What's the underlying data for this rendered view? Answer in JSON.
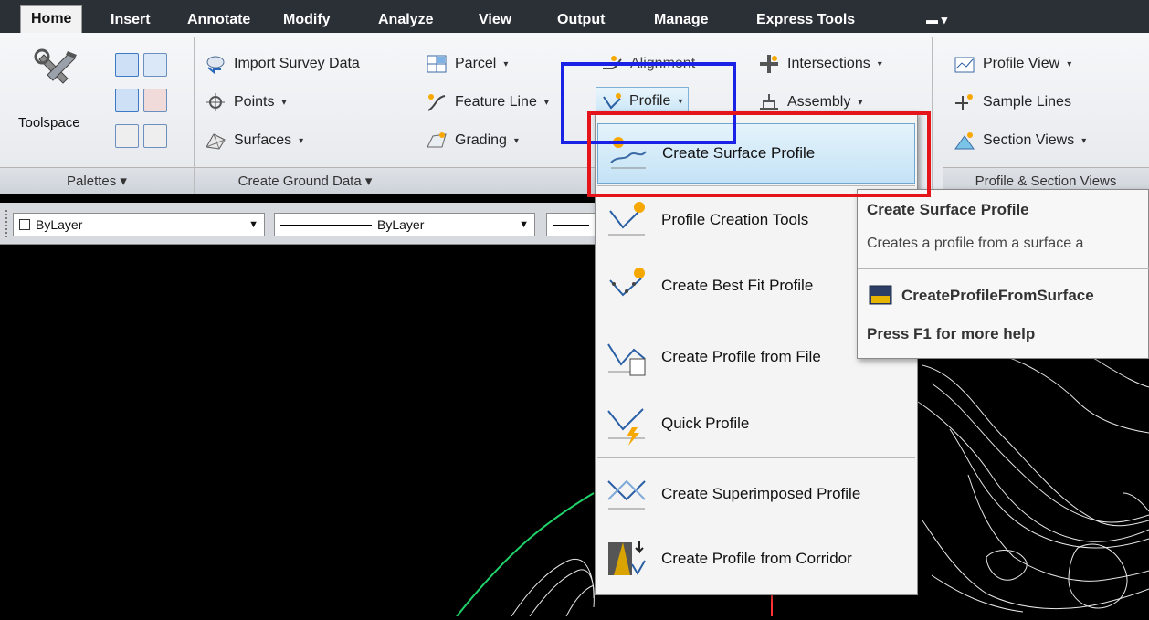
{
  "tabs": [
    "Home",
    "Insert",
    "Annotate",
    "Modify",
    "Analyze",
    "View",
    "Output",
    "Manage",
    "Express Tools"
  ],
  "ribbon": {
    "palettes": {
      "toolspace_label": "Toolspace",
      "footer": "Palettes ▾"
    },
    "ground": {
      "import": "Import Survey Data",
      "points": "Points",
      "surfaces": "Surfaces",
      "footer": "Create Ground Data ▾"
    },
    "design": {
      "parcel": "Parcel",
      "feature_line": "Feature Line",
      "grading": "Grading",
      "alignment": "Alignment",
      "profile": "Profile",
      "intersections": "Intersections",
      "assembly": "Assembly"
    },
    "views": {
      "profile_view": "Profile View",
      "sample_lines": "Sample Lines",
      "section_views": "Section Views",
      "footer": "Profile & Section Views"
    }
  },
  "propbar": {
    "color": "ByLayer",
    "linetype": "ByLayer"
  },
  "menu": {
    "items": [
      "Create Surface Profile",
      "Profile Creation Tools",
      "Create Best Fit Profile",
      "Create Profile from File",
      "Quick Profile",
      "Create Superimposed Profile",
      "Create Profile from Corridor"
    ]
  },
  "tooltip": {
    "title": "Create Surface Profile",
    "description": "Creates a profile from a surface a",
    "command": "CreateProfileFromSurface",
    "help": "Press F1 for more help"
  },
  "colors": {
    "highlight_blue": "#1a22e6",
    "highlight_red": "#e5141a",
    "terrain_green": "#1fd36a"
  }
}
